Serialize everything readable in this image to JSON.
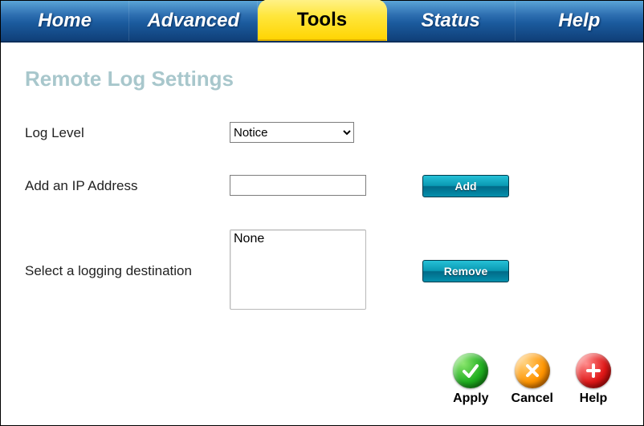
{
  "nav": {
    "tabs": [
      {
        "label": "Home",
        "active": false
      },
      {
        "label": "Advanced",
        "active": false
      },
      {
        "label": "Tools",
        "active": true
      },
      {
        "label": "Status",
        "active": false
      },
      {
        "label": "Help",
        "active": false
      }
    ]
  },
  "page": {
    "title": "Remote Log Settings"
  },
  "form": {
    "log_level": {
      "label": "Log Level",
      "selected": "Notice"
    },
    "add_ip": {
      "label": "Add an IP Address",
      "value": "",
      "button": "Add"
    },
    "destination": {
      "label": "Select a logging destination",
      "items": [
        "None"
      ],
      "button": "Remove"
    }
  },
  "footer": {
    "apply": "Apply",
    "cancel": "Cancel",
    "help": "Help"
  }
}
